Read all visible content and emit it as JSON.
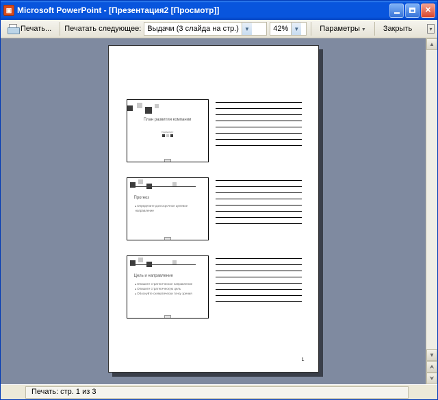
{
  "window": {
    "title": "Microsoft PowerPoint - [Презентация2 [Просмотр]]"
  },
  "toolbar": {
    "print_label": "Печать...",
    "print_next_label": "Печатать следующее:",
    "layout_combo": "Выдачи (3 слайда на стр.)",
    "zoom_combo": "42%",
    "params_label": "Параметры",
    "close_label": "Закрыть"
  },
  "handout": {
    "slides": [
      {
        "title": "План развития компании",
        "sub": "Название"
      },
      {
        "title": "Прогноз",
        "bullets": [
          "Определите долгосрочное целевое направление"
        ]
      },
      {
        "title": "Цель и направление",
        "bullets": [
          "Опишите стратегическое направление",
          "Опишите стратегическую цель",
          "Обоснуйте схематически точку зрения"
        ]
      }
    ],
    "page_number": "1"
  },
  "status": {
    "text": "Печать: стр. 1 из 3"
  }
}
